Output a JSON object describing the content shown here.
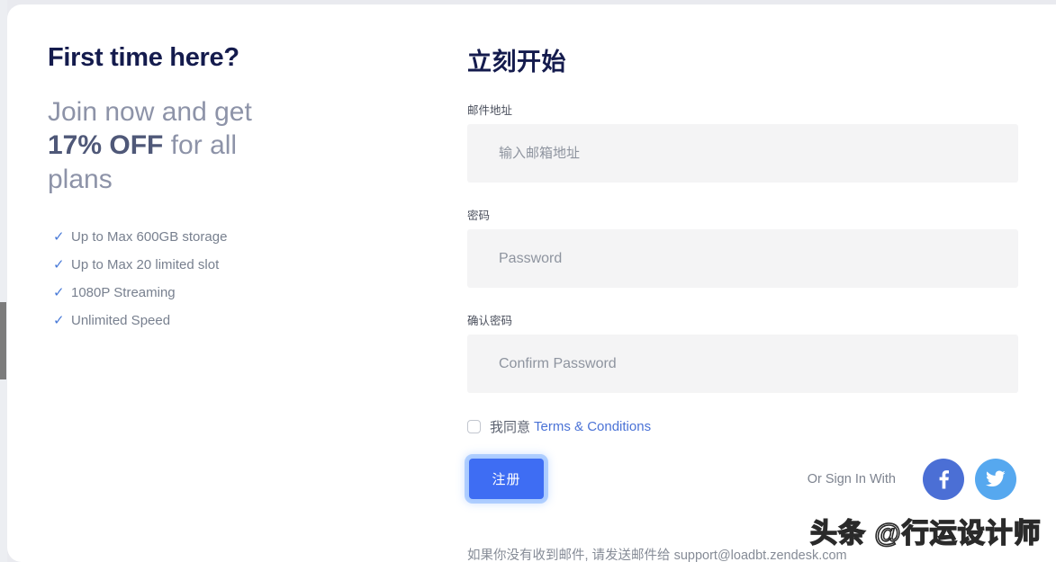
{
  "promo": {
    "title": "First time here?",
    "subtitle_prefix": "Join now and get",
    "subtitle_accent": "17% OFF",
    "subtitle_suffix": "for all plans",
    "check_icon": "✓",
    "features": [
      "Up to Max 600GB storage",
      "Up to Max 20 limited slot",
      "1080P Streaming",
      "Unlimited Speed"
    ]
  },
  "form": {
    "title": "立刻开始",
    "email": {
      "label": "邮件地址",
      "placeholder": "输入邮箱地址",
      "value": ""
    },
    "password": {
      "label": "密码",
      "placeholder": "Password",
      "value": ""
    },
    "confirm_password": {
      "label": "确认密码",
      "placeholder": "Confirm Password",
      "value": ""
    },
    "terms": {
      "checked": false,
      "text": "我同意",
      "link_label": "Terms & Conditions"
    },
    "submit_label": "注册",
    "social": {
      "label": "Or Sign In With",
      "facebook_icon": "facebook-icon",
      "twitter_icon": "twitter-icon"
    },
    "footer_note": "如果你没有收到邮件, 请发送邮件给 support@loadbt.zendesk.com"
  },
  "watermark": {
    "text": "头条 @行运设计师"
  },
  "colors": {
    "heading": "#141b4d",
    "muted": "#8d93a8",
    "accent_blue": "#3e6df3",
    "link_blue": "#4a72d6",
    "check_blue": "#4a7bd8",
    "input_bg": "#f4f4f5",
    "facebook": "#4b6fd5",
    "twitter": "#56a8ef"
  }
}
